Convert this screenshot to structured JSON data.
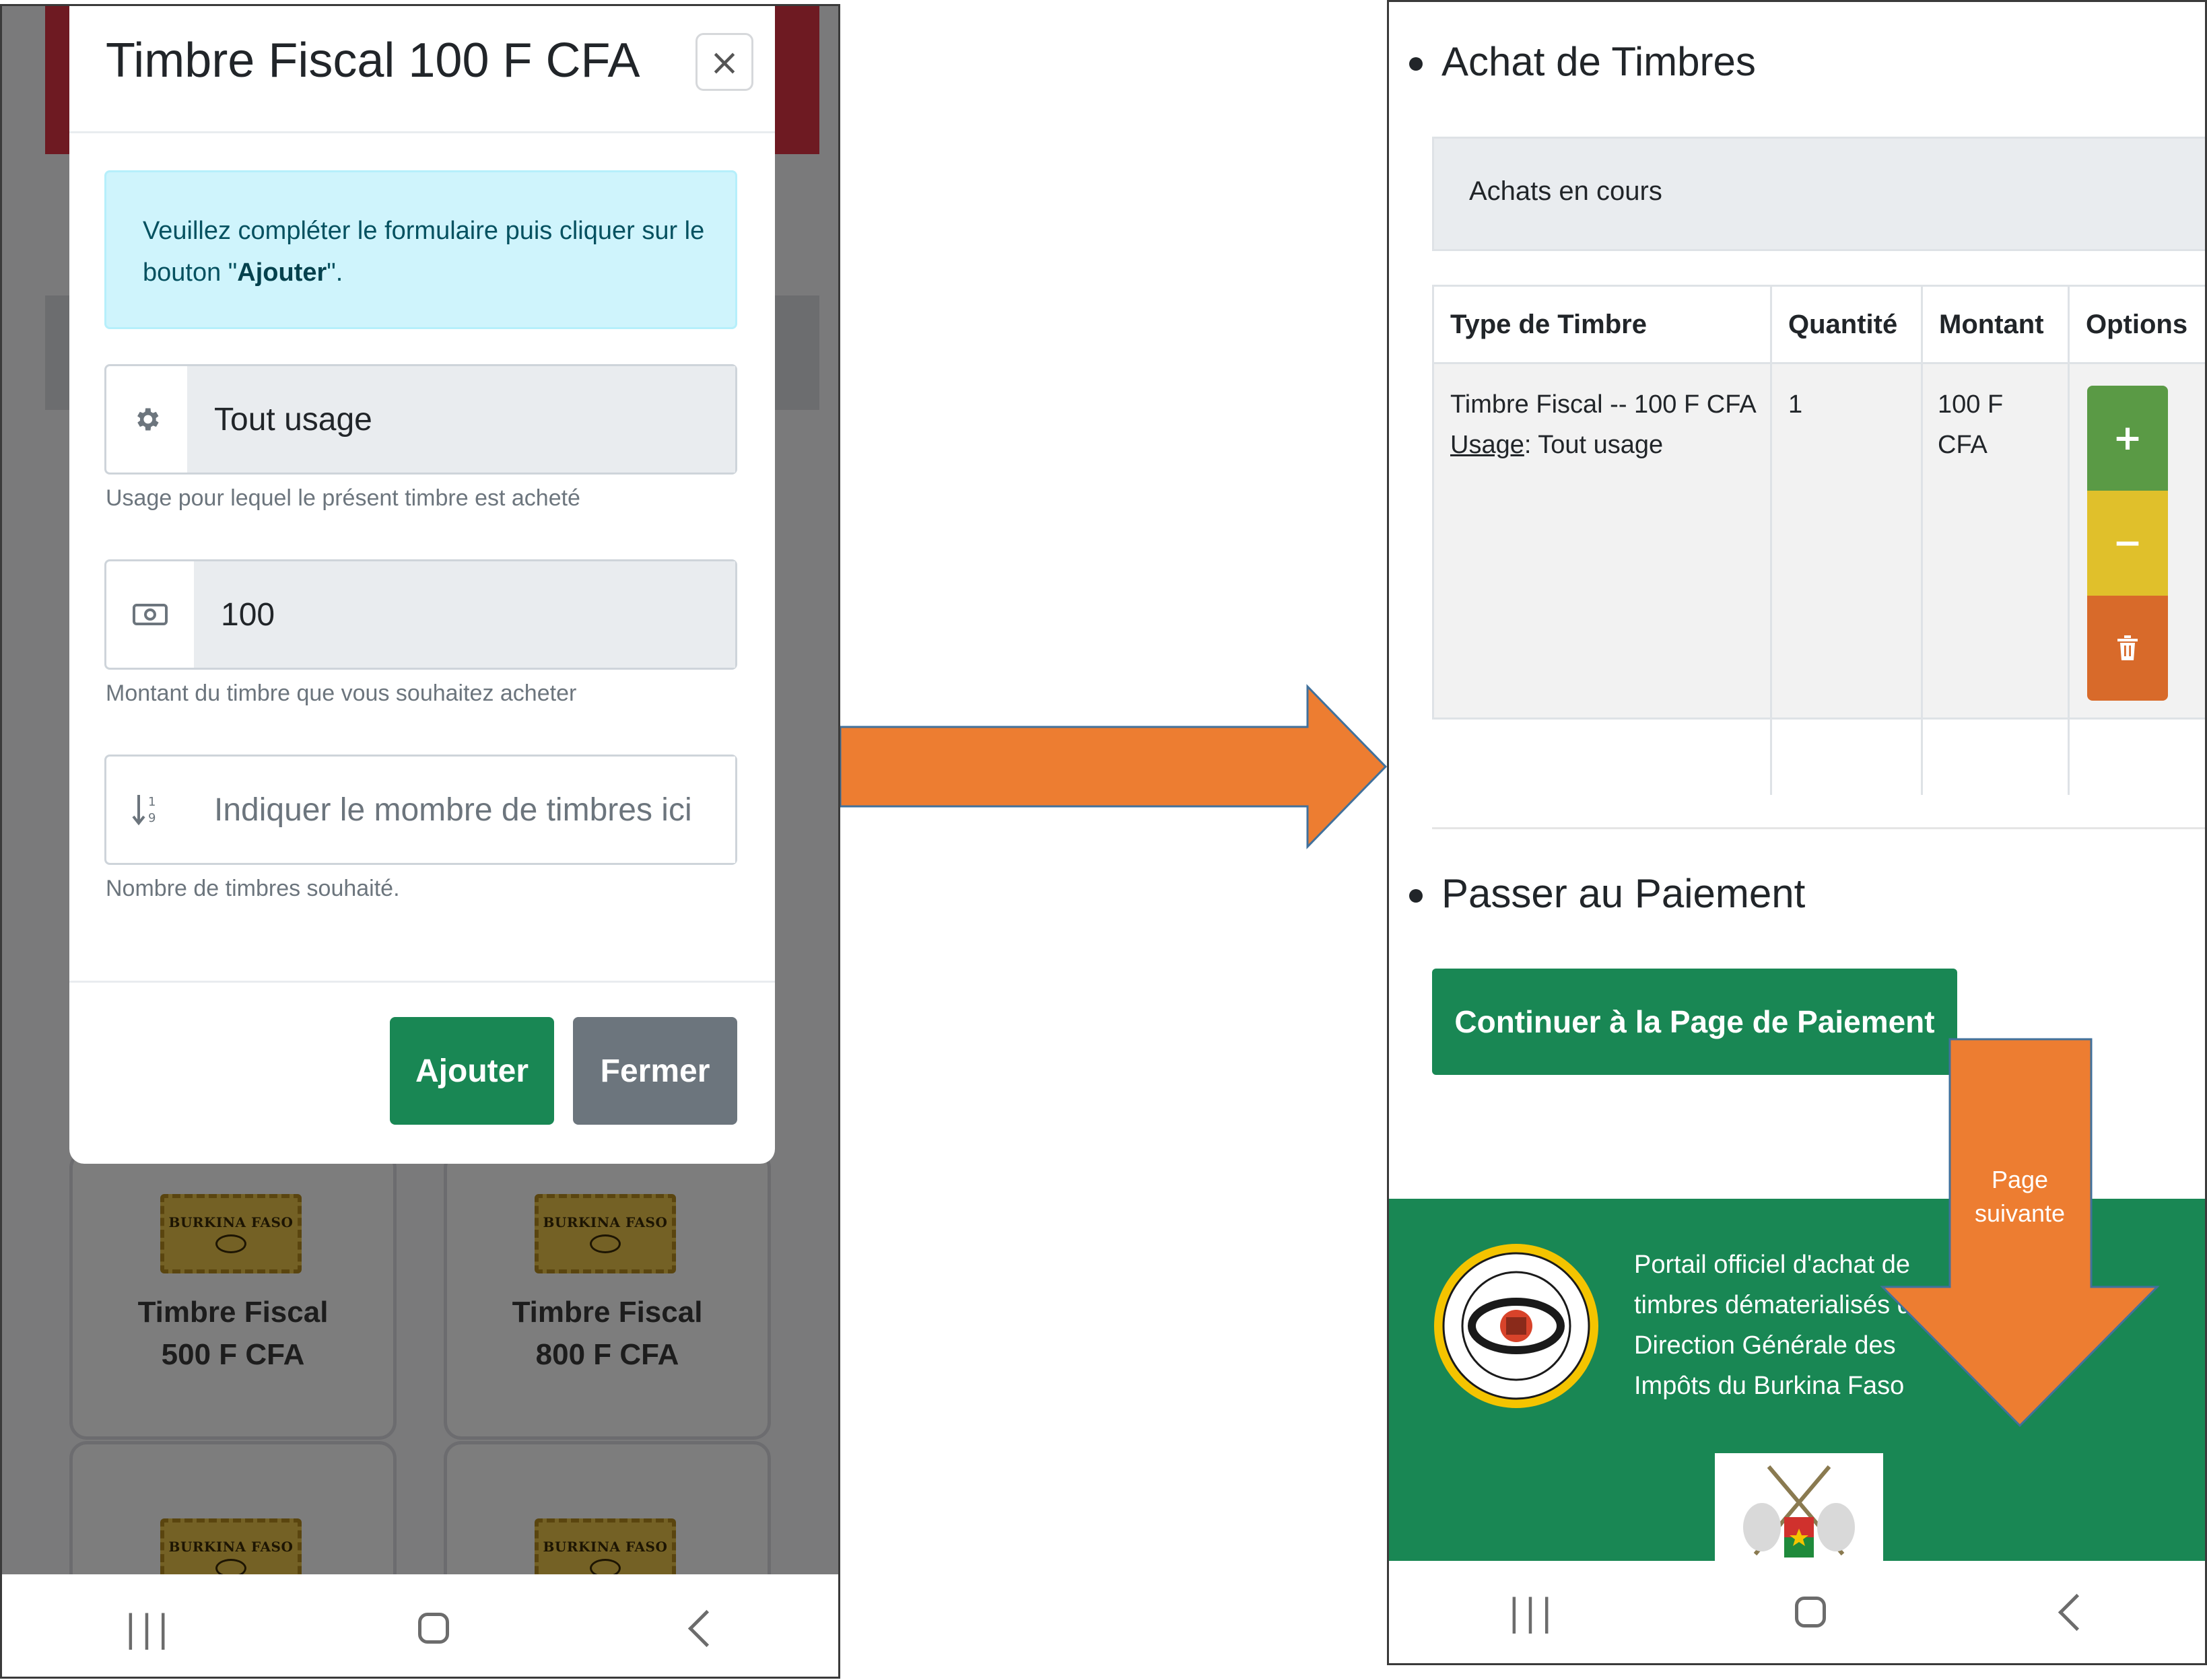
{
  "left_screen": {
    "modal": {
      "title": "Timbre Fiscal 100 F CFA",
      "close_symbol": "×",
      "alert": {
        "text_before": "Veuillez compléter le formulaire puis cliquer sur le bouton \"",
        "bold": "Ajouter",
        "text_after": "\"."
      },
      "usage_field": {
        "icon": "gear-icon",
        "value": "Tout usage",
        "help": "Usage pour lequel le présent timbre est acheté"
      },
      "amount_field": {
        "icon": "money-bill-icon",
        "value": "100",
        "help": "Montant du timbre que vous souhaitez acheter"
      },
      "quantity_field": {
        "icon": "sort-numeric-icon",
        "placeholder": "Indiquer le mombre de timbres ici",
        "help": "Nombre de timbres souhaité."
      },
      "add_button": "Ajouter",
      "close_button": "Fermer"
    },
    "background_cards": [
      {
        "stamp_text": "BURKINA FASO",
        "title_line1": "Timbre Fiscal",
        "title_line2": "500 F CFA"
      },
      {
        "stamp_text": "BURKINA FASO",
        "title_line1": "Timbre Fiscal",
        "title_line2": "800 F CFA"
      },
      {
        "stamp_text": "BURKINA FASO"
      },
      {
        "stamp_text": "BURKINA FASO"
      }
    ]
  },
  "right_screen": {
    "section1_title": "Achat de Timbres",
    "cart_header": "Achats en cours",
    "table": {
      "columns": [
        "Type de Timbre",
        "Quantité",
        "Montant",
        "Options"
      ],
      "row": {
        "type_line1": "Timbre Fiscal -- 100 F CFA",
        "usage_label": "Usage",
        "usage_value": ": Tout usage",
        "quantity": "1",
        "amount_line1": "100 F",
        "amount_line2": "CFA"
      },
      "option_buttons": [
        {
          "icon": "plus-icon",
          "symbol": "+",
          "color": "#5a9a45"
        },
        {
          "icon": "minus-icon",
          "symbol": "−",
          "color": "#e0c02b"
        },
        {
          "icon": "trash-icon",
          "symbol": "🗑",
          "color": "#d86a2a"
        }
      ]
    },
    "section2_title": "Passer au Paiement",
    "continue_button": "Continuer à la Page de Paiement",
    "footer_text": "Portail officiel d'achat de timbres dématerialisés de la Direction Générale des Impôts du Burkina Faso"
  },
  "annotation": {
    "down_arrow_label_line1": "Page",
    "down_arrow_label_line2": "suivante",
    "arrow_color": "#ed7d31"
  },
  "colors": {
    "success": "#198754",
    "secondary": "#6c757d",
    "info_bg": "#cff4fc",
    "info_text": "#055160"
  }
}
